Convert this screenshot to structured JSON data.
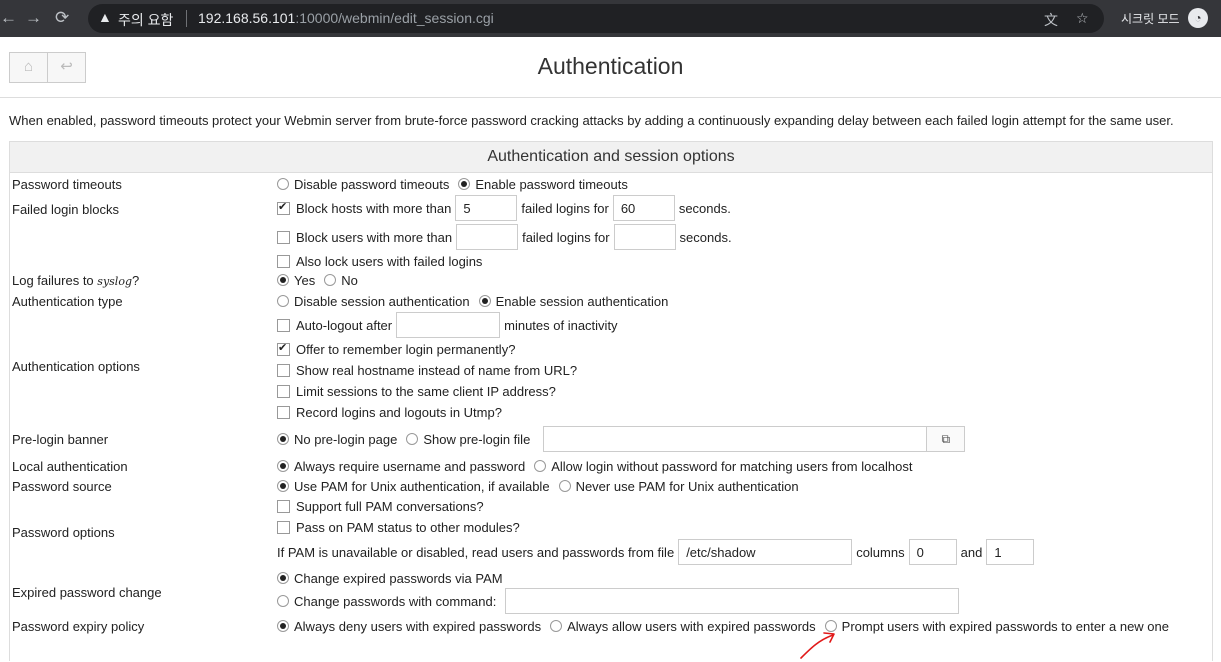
{
  "browser": {
    "security_label": "주의 요함",
    "url_host": "192.168.56.101",
    "url_path": ":10000/webmin/edit_session.cgi",
    "incognito_label": "시크릿 모드"
  },
  "page": {
    "title": "Authentication",
    "intro": "When enabled, password timeouts protect your Webmin server from brute-force password cracking attacks by adding a continuously expanding delay between each failed login attempt for the same user.",
    "section_title": "Authentication and session options"
  },
  "labels": {
    "password_timeouts": "Password timeouts",
    "failed_login_blocks": "Failed login blocks",
    "log_failures_prefix": "Log failures to",
    "log_failures_em": "syslog",
    "log_failures_suffix": "?",
    "authentication_type": "Authentication type",
    "authentication_options": "Authentication options",
    "pre_login_banner": "Pre-login banner",
    "local_authentication": "Local authentication",
    "password_source": "Password source",
    "password_options": "Password options",
    "expired_password_change": "Expired password change",
    "password_expiry_policy": "Password expiry policy"
  },
  "options": {
    "disable_timeouts": "Disable password timeouts",
    "enable_timeouts": "Enable password timeouts",
    "block_hosts": "Block hosts with more than",
    "block_hosts_value": "5",
    "failed_logins_for": "failed logins for",
    "block_hosts_seconds_value": "60",
    "seconds": "seconds.",
    "block_users": "Block users with more than",
    "block_users_value": "",
    "block_users_seconds_value": "",
    "lock_users": "Also lock users with failed logins",
    "yes": "Yes",
    "no": "No",
    "disable_session": "Disable session authentication",
    "enable_session": "Enable session authentication",
    "auto_logout": "Auto-logout after",
    "auto_logout_value": "",
    "minutes_inactivity": "minutes of inactivity",
    "remember_login": "Offer to remember login permanently?",
    "real_hostname": "Show real hostname instead of name from URL?",
    "limit_sessions": "Limit sessions to the same client IP address?",
    "record_logins": "Record logins and logouts in Utmp?",
    "no_prelogin": "No pre-login page",
    "show_prelogin": "Show pre-login file",
    "prelogin_file_value": "",
    "always_require": "Always require username and password",
    "allow_without_password": "Allow login without password for matching users from localhost",
    "use_pam": "Use PAM for Unix authentication, if available",
    "never_pam": "Never use PAM for Unix authentication",
    "full_pam": "Support full PAM conversations?",
    "pass_pam_status": "Pass on PAM status to other modules?",
    "pam_unavailable": "If PAM is unavailable or disabled, read users and passwords from file",
    "shadow_file_value": "/etc/shadow",
    "columns": "columns",
    "columns_value_1": "0",
    "and": "and",
    "columns_value_2": "1",
    "change_via_pam": "Change expired passwords via PAM",
    "change_with_command": "Change passwords with command:",
    "change_command_value": "",
    "always_deny": "Always deny users with expired passwords",
    "always_allow": "Always allow users with expired passwords",
    "prompt_new": "Prompt users with expired passwords to enter a new one"
  },
  "colors": {
    "chrome_bg": "#35363a",
    "annotation_arrow": "#e11919"
  }
}
